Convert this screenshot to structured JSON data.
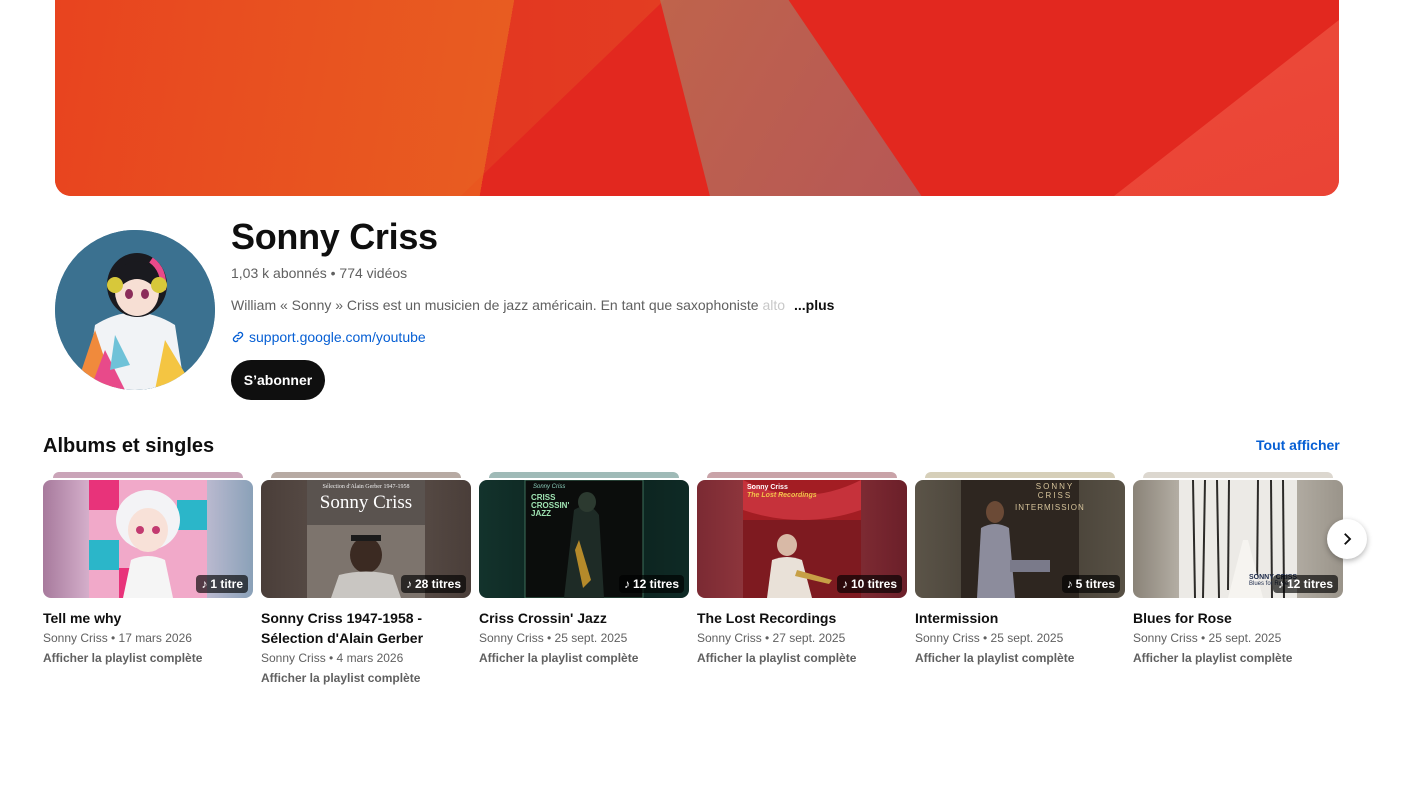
{
  "channel": {
    "name": "Sonny Criss",
    "stats": "1,03 k abonnés • 774 vidéos",
    "description": "William « Sonny » Criss est un musicien de jazz américain. En tant que saxophoniste",
    "description_fade": " alto",
    "more_label": "...plus",
    "link_text": "support.google.com/youtube",
    "subscribe_label": "S’abonner"
  },
  "section": {
    "title": "Albums et singles",
    "see_all_label": "Tout afficher"
  },
  "albums": [
    {
      "title": "Tell me why",
      "title2": "",
      "artist_date": "Sonny Criss • 17 mars 2026",
      "count": "1 titre",
      "link": "Afficher la playlist complète"
    },
    {
      "title": "Sonny Criss 1947-1958 -",
      "title2": "Sélection d'Alain Gerber",
      "artist_date": "Sonny Criss • 4 mars 2026",
      "count": "28 titres",
      "link": "Afficher la playlist complète",
      "cover_small": "Sélection d'Alain Gerber 1947-1958",
      "cover_big": "Sonny Criss"
    },
    {
      "title": "Criss Crossin' Jazz",
      "title2": "",
      "artist_date": "Sonny Criss • 25 sept. 2025",
      "count": "12 titres",
      "link": "Afficher la playlist complète",
      "cover_small": "Sonny Criss",
      "cover_big": "CRISS CROSSIN' JAZZ"
    },
    {
      "title": "The Lost Recordings",
      "title2": "",
      "artist_date": "Sonny Criss • 27 sept. 2025",
      "count": "10 titres",
      "link": "Afficher la playlist complète",
      "cover_small": "Sonny Criss",
      "cover_big": "The Lost Recordings"
    },
    {
      "title": "Intermission",
      "title2": "",
      "artist_date": "Sonny Criss • 25 sept. 2025",
      "count": "5 titres",
      "link": "Afficher la playlist complète",
      "cover_small": "SONNY CRISS",
      "cover_big": "INTERMISSION"
    },
    {
      "title": "Blues for Rose",
      "title2": "",
      "artist_date": "Sonny Criss • 25 sept. 2025",
      "count": "12 titres",
      "link": "Afficher la playlist complète",
      "cover_small": "SONNY CRISS",
      "cover_big": "Blues for Rose"
    }
  ]
}
